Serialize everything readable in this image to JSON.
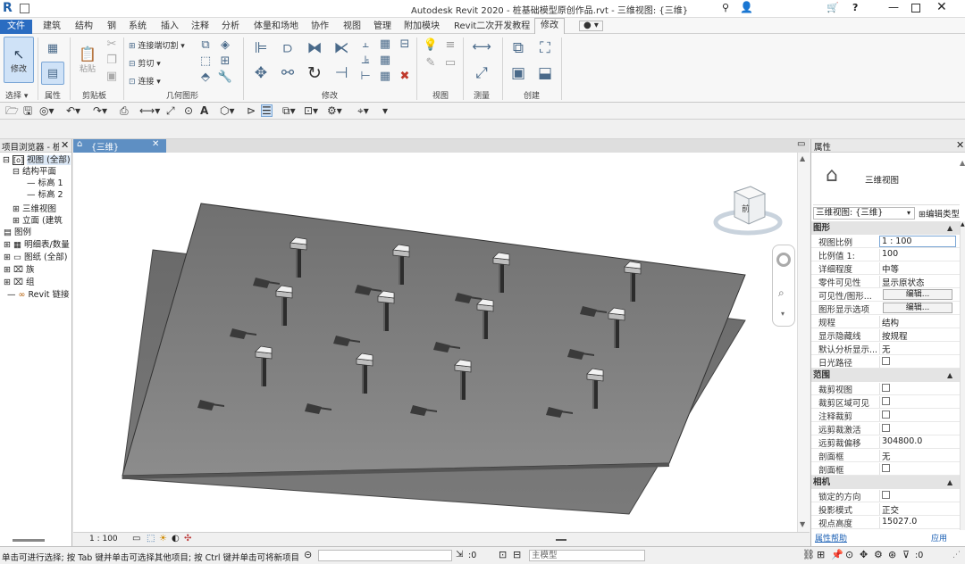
{
  "app": {
    "title": "Autodesk Revit 2020 -  桩基础模型原创作品.rvt - 三维视图: {三维}",
    "logo": "R"
  },
  "titlebar": {
    "user_icon": "user-icon",
    "help": "?"
  },
  "tabs": [
    "文件",
    "建筑",
    "结构",
    "钢",
    "系统",
    "插入",
    "注释",
    "分析",
    "体量和场地",
    "协作",
    "视图",
    "管理",
    "附加模块",
    "Revit二次开发教程",
    "修改"
  ],
  "active_tab": "修改",
  "ribbon": {
    "groups": [
      "选择",
      "属性",
      "剪贴板",
      "几何图形",
      "修改",
      "视图",
      "测量",
      "创建"
    ],
    "modify_label": "修改",
    "paste_label": "粘贴",
    "cope_label": "连接端切割",
    "cut_label": "剪切",
    "join_label": "连接",
    "select_dropdown": "选择 ▾"
  },
  "project_browser": {
    "title": "项目浏览器 - 桩",
    "items": [
      "视图 (全部)",
      "结构平面",
      "标高 1",
      "标高 2",
      "三维视图",
      "立面 (建筑",
      "图例",
      "明细表/数量",
      "图纸 (全部)",
      "族",
      "组",
      "Revit 链接"
    ]
  },
  "view": {
    "tab_label": "{三维}",
    "scale": "1 : 100",
    "viewcube_label": "前"
  },
  "properties": {
    "title": "属性",
    "type_name": "三维视图",
    "instance_selector": "三维视图: {三维}",
    "edit_type": "编辑类型",
    "sections": [
      {
        "name": "图形",
        "rows": [
          {
            "k": "视图比例",
            "v": "1 : 100"
          },
          {
            "k": "比例值 1:",
            "v": "100"
          },
          {
            "k": "详细程度",
            "v": "中等"
          },
          {
            "k": "零件可见性",
            "v": "显示原状态"
          },
          {
            "k": "可见性/图形...",
            "v": "编辑..."
          },
          {
            "k": "图形显示选项",
            "v": "编辑..."
          },
          {
            "k": "规程",
            "v": "结构"
          },
          {
            "k": "显示隐藏线",
            "v": "按规程"
          },
          {
            "k": "默认分析显示...",
            "v": "无"
          },
          {
            "k": "日光路径",
            "v": ""
          }
        ]
      },
      {
        "name": "范围",
        "rows": [
          {
            "k": "裁剪视图",
            "v": ""
          },
          {
            "k": "裁剪区域可见",
            "v": ""
          },
          {
            "k": "注释裁剪",
            "v": ""
          },
          {
            "k": "远剪裁激活",
            "v": ""
          },
          {
            "k": "远剪裁偏移",
            "v": "304800.0"
          },
          {
            "k": "剖面框",
            "v": "无"
          },
          {
            "k": "剖面框",
            "v": ""
          }
        ]
      },
      {
        "name": "相机",
        "rows": [
          {
            "k": "锁定的方向",
            "v": ""
          },
          {
            "k": "投影模式",
            "v": "正交"
          },
          {
            "k": "视点高度",
            "v": "15027.0"
          }
        ]
      }
    ],
    "help_link": "属性帮助",
    "apply": "应用"
  },
  "status": {
    "message": "单击可进行选择; 按 Tab 键并单击可选择其他项目; 按 Ctrl 键并单击可将新项目",
    "count": ":0",
    "model": "主模型",
    "filter": ":0"
  }
}
